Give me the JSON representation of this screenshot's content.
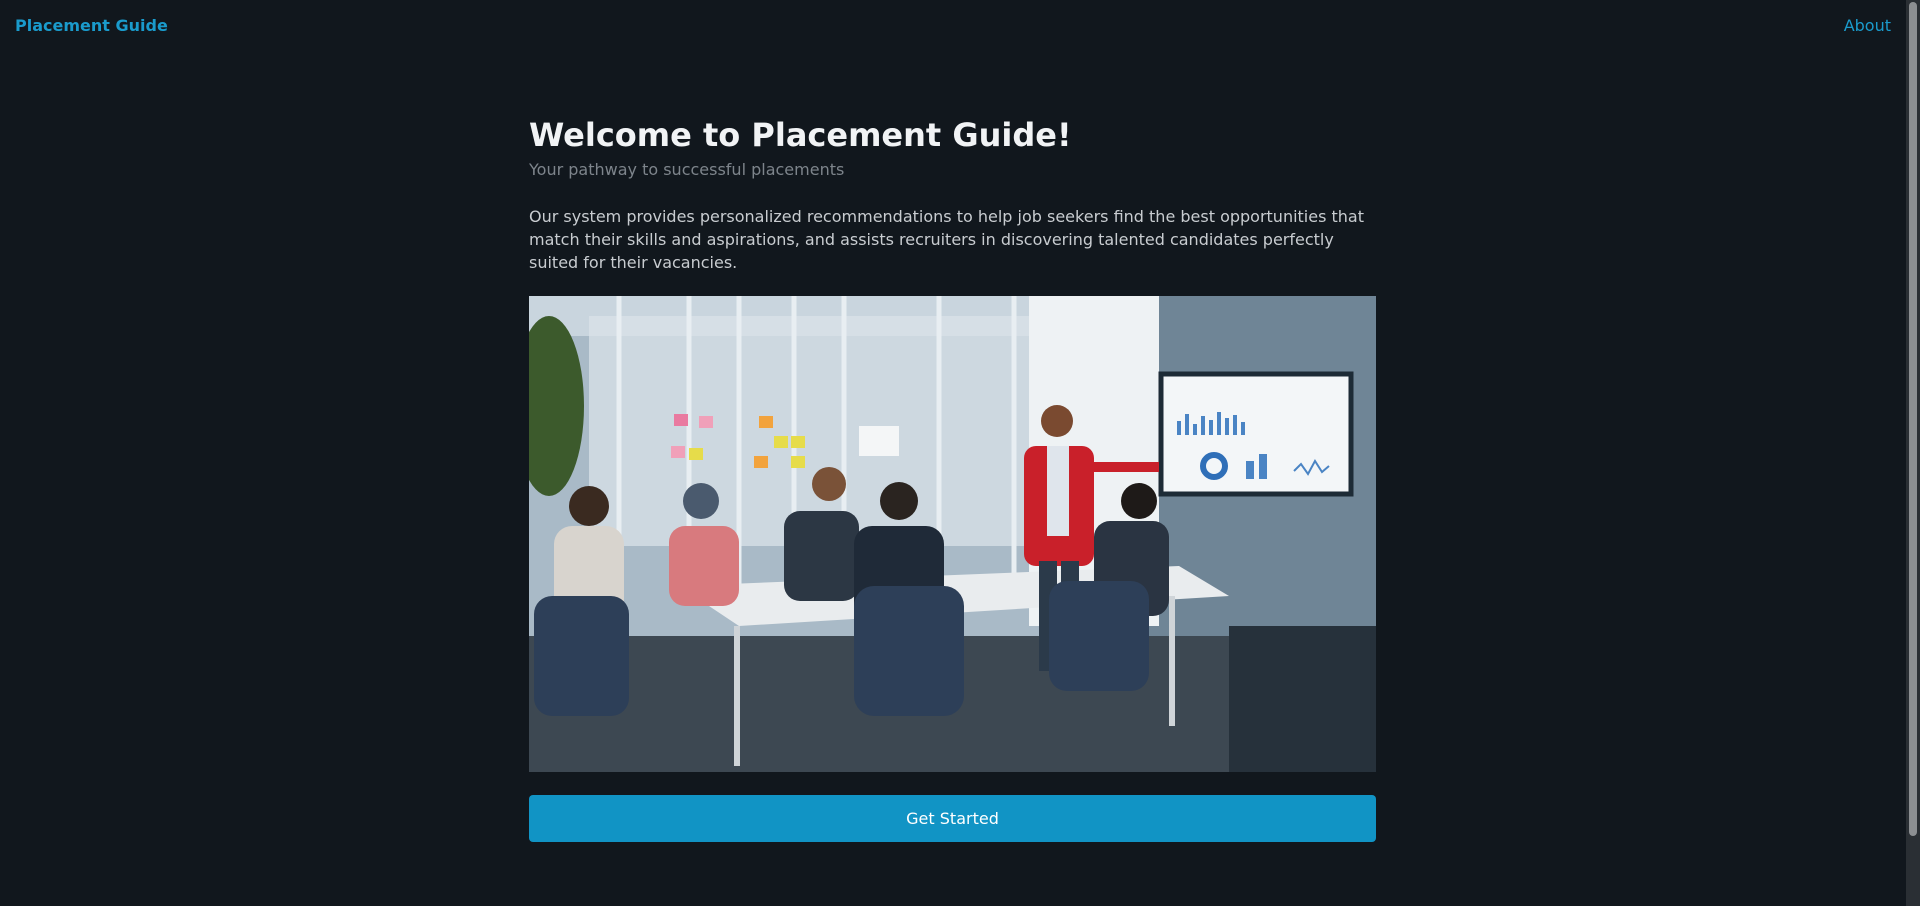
{
  "navbar": {
    "brand": "Placement Guide",
    "about_link": "About"
  },
  "hero": {
    "title": "Welcome to Placement Guide!",
    "subtitle": "Your pathway to successful placements",
    "description": "Our system provides personalized recommendations to help job seekers find the best opportunities that match their skills and aspirations, and assists recruiters in discovering talented candidates perfectly suited for their vacancies.",
    "image_icon": "meeting-photo",
    "cta_label": "Get Started"
  },
  "colors": {
    "background": "#11171d",
    "accent": "#1a9bcc",
    "button": "#1194c5"
  }
}
